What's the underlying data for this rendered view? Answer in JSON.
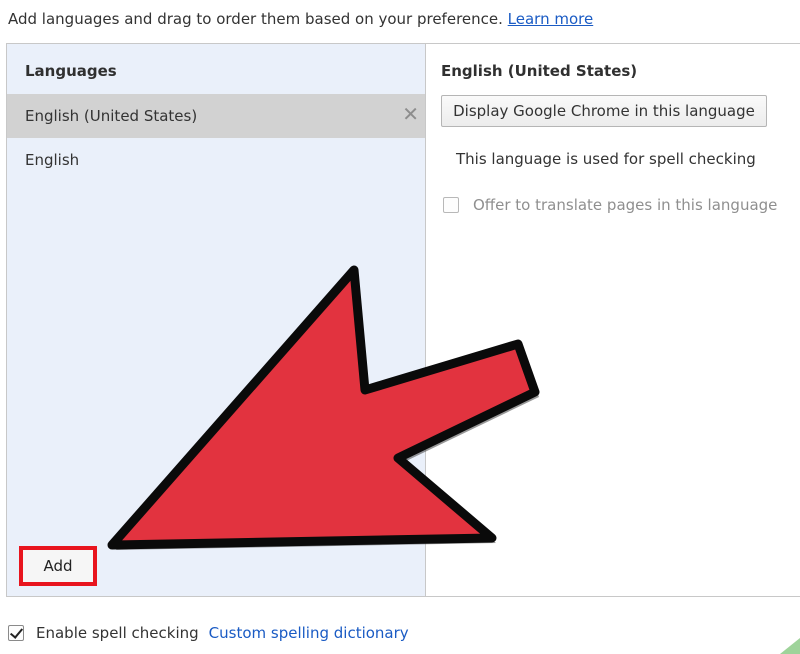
{
  "intro": {
    "text": "Add languages and drag to order them based on your preference.",
    "learn_more": "Learn more"
  },
  "languages": {
    "title": "Languages",
    "items": [
      {
        "label": "English (United States)",
        "selected": true
      },
      {
        "label": "English",
        "selected": false
      }
    ],
    "add_label": "Add"
  },
  "detail": {
    "title": "English (United States)",
    "display_button": "Display Google Chrome in this language",
    "spell_note": "This language is used for spell checking",
    "translate_offer": "Offer to translate pages in this language"
  },
  "spell": {
    "enable_label": "Enable spell checking",
    "enabled": true,
    "custom_dictionary": "Custom spelling dictionary"
  },
  "colors": {
    "arrow_fill": "#e2333f",
    "highlight_box": "#e8141e",
    "link": "#1a5bc4",
    "left_panel_bg": "#eaf0fa"
  },
  "icons": {
    "remove": "close-icon",
    "arrow": "pointer-arrow-icon"
  }
}
